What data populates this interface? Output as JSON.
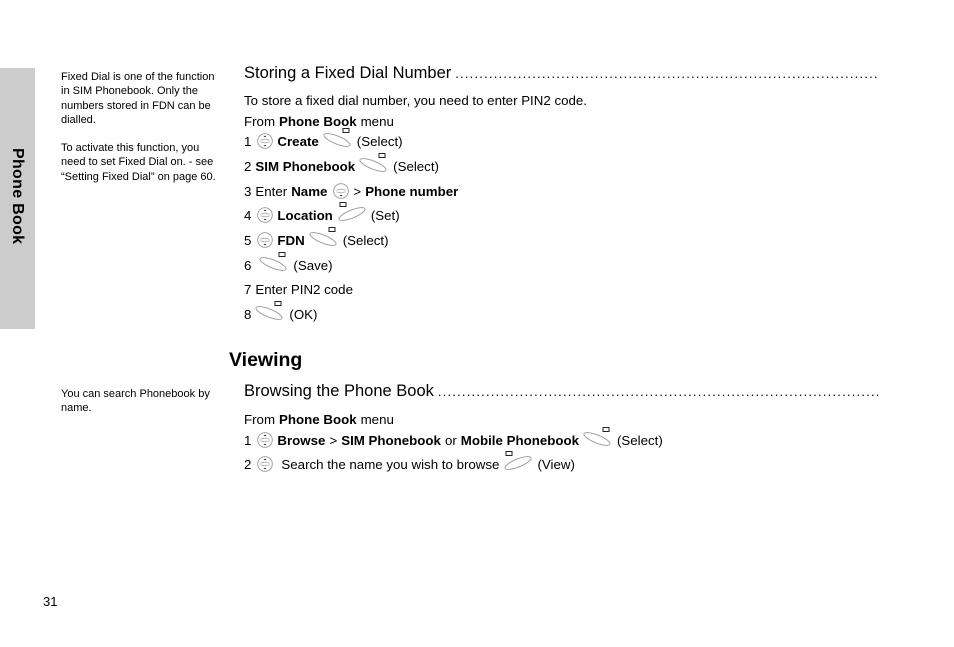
{
  "side_tab": {
    "label": "Phone Book",
    "color": "#cccccc"
  },
  "notes": {
    "fdn": [
      "Fixed Dial is one of the function in SIM Phonebook. Only the numbers stored in FDN can be dialled.",
      "To activate this function, you need to set Fixed Dial on. - see “Setting Fixed Dial” on page 60."
    ],
    "search": "You can search Phonebook by name."
  },
  "page_number": "31",
  "storing": {
    "heading": "Storing a Fixed Dial Number",
    "intro": "To store a fixed dial number, you need to enter PIN2 code.",
    "from_prefix": "From",
    "from_bold": "Phone Book",
    "from_suffix": "menu",
    "steps": [
      {
        "num": "1",
        "bold": "Create",
        "action": "(Select)"
      },
      {
        "num": "2",
        "bold": "SIM Phonebook",
        "action": "(Select)"
      },
      {
        "num": "3",
        "prefix": "Enter",
        "bold": "Name",
        "sep": ">",
        "bold2": "Phone number"
      },
      {
        "num": "4",
        "bold": "Location",
        "action": "(Set)"
      },
      {
        "num": "5",
        "bold": "FDN",
        "action": "(Select)"
      },
      {
        "num": "6",
        "action": "(Save)"
      },
      {
        "num": "7",
        "text": "Enter PIN2 code"
      },
      {
        "num": "8",
        "action": "(OK)"
      }
    ]
  },
  "viewing": {
    "title": "Viewing",
    "heading": "Browsing the Phone Book",
    "from_prefix": "From",
    "from_bold": "Phone Book",
    "from_suffix": "menu",
    "steps": [
      {
        "num": "1",
        "bold": "Browse",
        "sep": ">",
        "bold2": "SIM Phonebook",
        "or": "or",
        "bold3": "Mobile Phonebook",
        "action": "(Select)"
      },
      {
        "num": "2",
        "text": "Search the name you wish to browse",
        "action": "(View)"
      }
    ]
  },
  "icons": {
    "nav_updown": "navigation-key-up-down-icon",
    "nav_down": "navigation-key-down-icon",
    "soft_right": "right-soft-key-icon",
    "soft_left": "left-soft-key-icon"
  }
}
